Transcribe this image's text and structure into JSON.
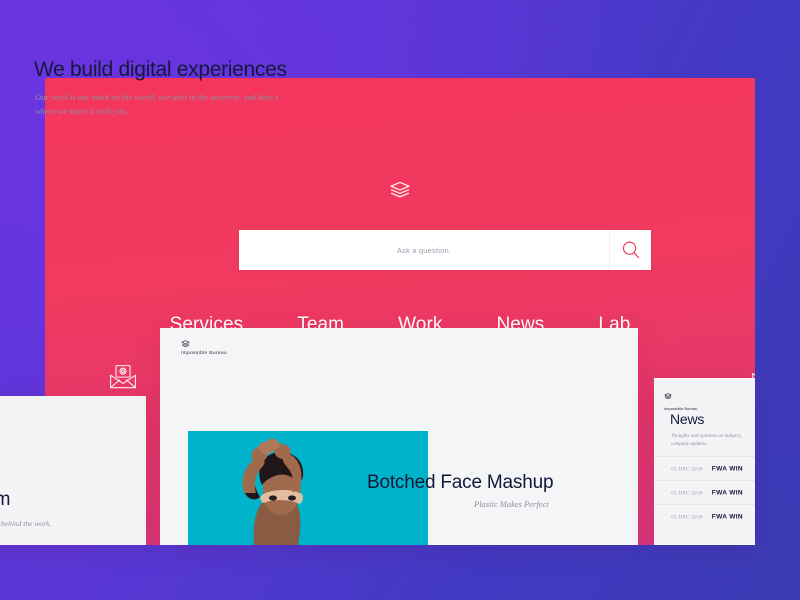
{
  "theme": {
    "bg_gradient_from": "#6134DC",
    "bg_gradient_to": "#3A3BB4",
    "panel_gradient_from": "#F4365D",
    "panel_gradient_to": "#D93780",
    "accent_teal": "#00B3CB",
    "card_bg": "#F4F4F6",
    "ink": "#15183A",
    "muted": "#8D90A0"
  },
  "header": {
    "logo_icon": "layers-stack-icon",
    "brand": "Impossible Bureau"
  },
  "search": {
    "placeholder": "Ask a question.",
    "value": "",
    "button_icon": "search-icon"
  },
  "nav": {
    "items": [
      {
        "label": "Services",
        "active": false
      },
      {
        "label": "Team",
        "active": false
      },
      {
        "label": "Work",
        "active": true
      },
      {
        "label": "News",
        "active": false
      },
      {
        "label": "Lab",
        "active": false
      }
    ]
  },
  "decor": {
    "left_icon": "envelope-at-icon",
    "right_icon": "envelope-letter-icon"
  },
  "work_card": {
    "brand": "Impossible Bureau",
    "title": "We build digital experiences",
    "subtitle": "Our work is our mark on the world, our dent in the universe, and here's where we share it with you.",
    "project_title": "Botched Face Mashup",
    "project_subtitle": "Plastic Makes Perfect"
  },
  "team_card": {
    "title": "Team",
    "subtitle": "The people behind the work."
  },
  "news_card": {
    "brand": "Impossible Bureau",
    "title": "News",
    "subtitle": "Thoughts and opinions on industry, company updates.",
    "rows": [
      {
        "date": "05 DEC 2018",
        "tag": "FWA WIN"
      },
      {
        "date": "05 DEC 2018",
        "tag": "FWA WIN"
      },
      {
        "date": "05 DEC 2018",
        "tag": "FWA WIN"
      }
    ]
  }
}
